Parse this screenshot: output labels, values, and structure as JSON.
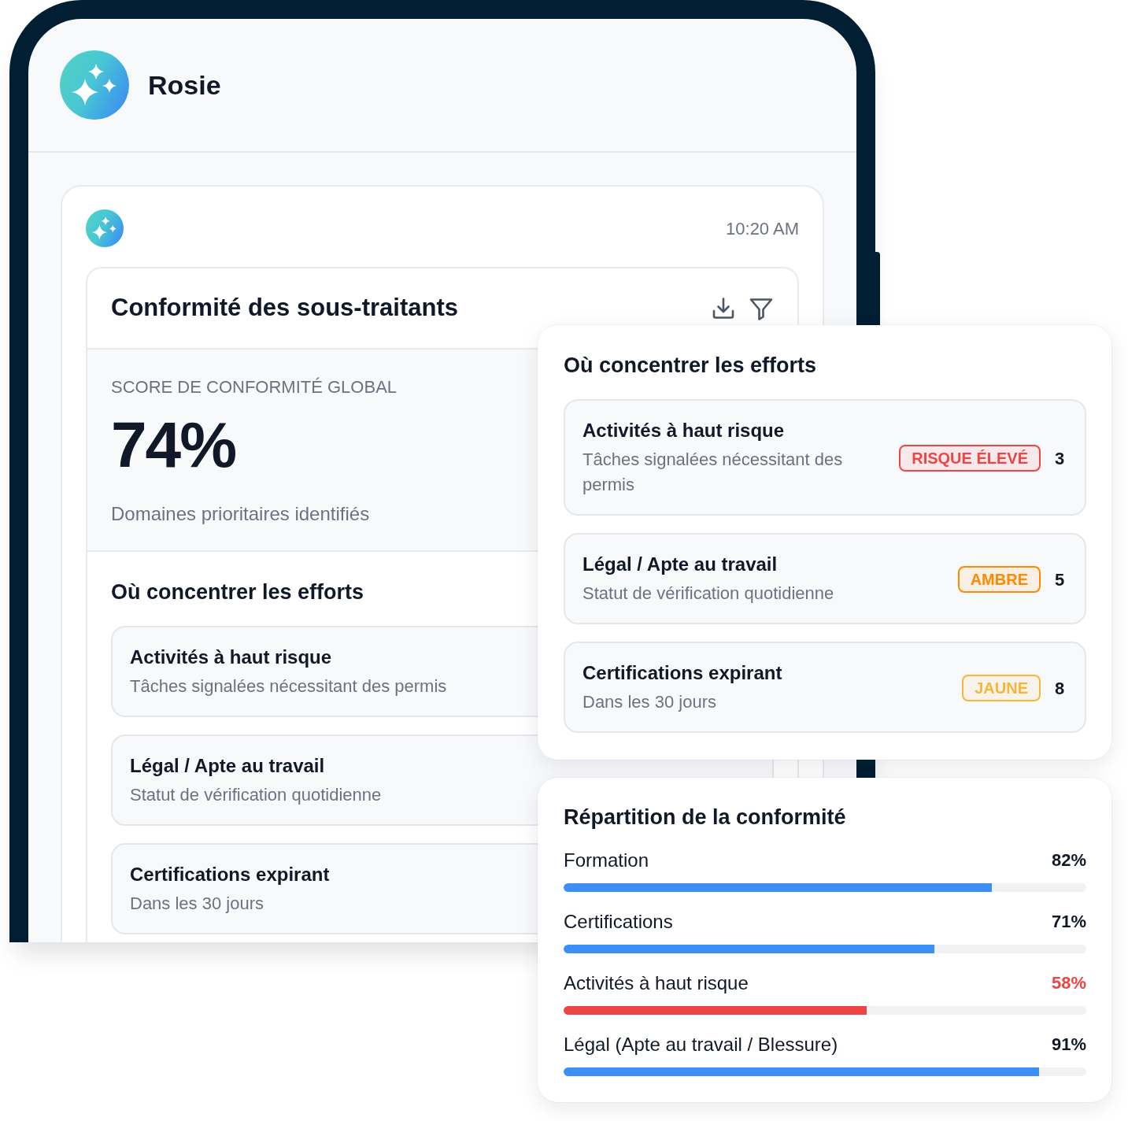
{
  "app": {
    "name": "Rosie"
  },
  "message": {
    "time": "10:20 AM",
    "report": {
      "title": "Conformité des sous-traitants",
      "score": {
        "label": "SCORE DE CONFORMITÉ GLOBAL",
        "value": "74%",
        "caption": "Domaines prioritaires identifiés"
      },
      "focus": {
        "title": "Où concentrer les efforts",
        "items": [
          {
            "title": "Activités à haut risque",
            "subtitle": "Tâches signalées nécessitant des permis"
          },
          {
            "title": "Légal / Apte au travail",
            "subtitle": "Statut de vérification quotidienne"
          },
          {
            "title": "Certifications expirant",
            "subtitle": "Dans les 30 jours"
          }
        ]
      }
    }
  },
  "focus_panel": {
    "title": "Où concentrer les efforts",
    "items": [
      {
        "title": "Activités à haut risque",
        "subtitle": "Tâches signalées nécessitant des permis",
        "badge": {
          "text": "RISQUE ÉLEVÉ",
          "color": "#ef4444"
        },
        "count": "3"
      },
      {
        "title": "Légal / Apte au travail",
        "subtitle": "Statut de vérification quotidienne",
        "badge": {
          "text": "AMBRE",
          "color": "#ff8a00"
        },
        "count": "5"
      },
      {
        "title": "Certifications expirant",
        "subtitle": "Dans les 30 jours",
        "badge": {
          "text": "JAUNE",
          "color": "#f8b638"
        },
        "count": "8"
      }
    ]
  },
  "breakdown_panel": {
    "title": "Répartition de la conformité",
    "rows": [
      {
        "label": "Formation",
        "value": "82%",
        "level": 0.82,
        "alert": false
      },
      {
        "label": "Certifications",
        "value": "71%",
        "level": 0.71,
        "alert": false
      },
      {
        "label": "Activités à haut risque",
        "value": "58%",
        "level": 0.58,
        "alert": true
      },
      {
        "label": "Légal (Apte au travail / Blessure)",
        "value": "91%",
        "level": 0.91,
        "alert": false
      }
    ]
  }
}
